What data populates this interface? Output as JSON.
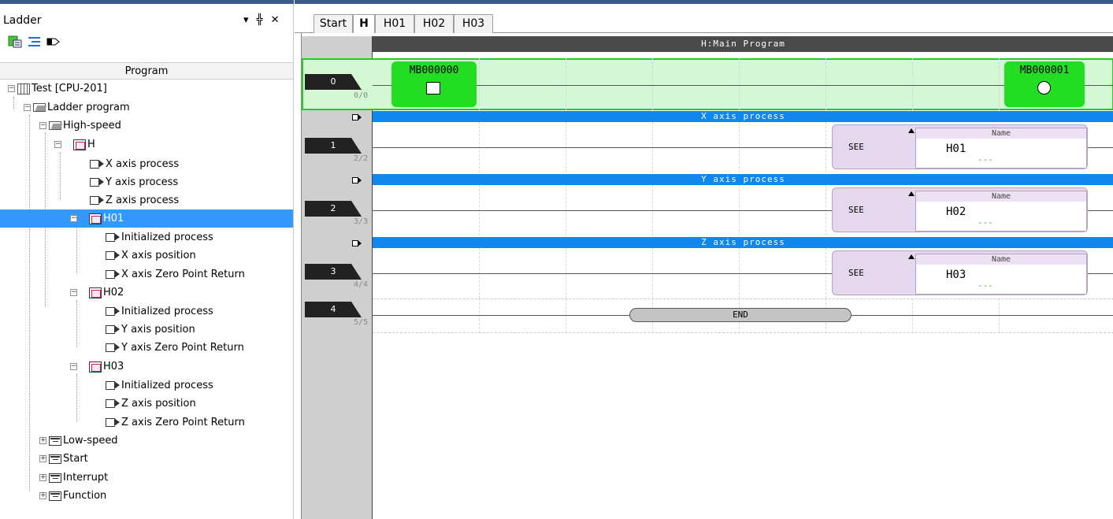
{
  "left_pane": {
    "title": "Ladder",
    "controls": "▾ ╬ ✕",
    "program_header": "Program",
    "tree": [
      {
        "label": "Test [CPU-201]",
        "icon": "cpu-icon"
      },
      {
        "label": "Ladder program",
        "icon": "folder-open-icon"
      },
      {
        "label": "High-speed",
        "icon": "folder-open-icon"
      },
      {
        "label": "H",
        "icon": "program-icon"
      },
      {
        "label": "X axis process",
        "icon": "tag-icon"
      },
      {
        "label": "Y axis process",
        "icon": "tag-icon"
      },
      {
        "label": "Z axis process",
        "icon": "tag-icon"
      },
      {
        "label": "H01",
        "icon": "program-icon",
        "selected": true
      },
      {
        "label": "Initialized process",
        "icon": "tag-icon"
      },
      {
        "label": "X axis position",
        "icon": "tag-icon"
      },
      {
        "label": "X axis Zero Point Return",
        "icon": "tag-icon"
      },
      {
        "label": "H02",
        "icon": "program-icon"
      },
      {
        "label": "Initialized process",
        "icon": "tag-icon"
      },
      {
        "label": "Y axis position",
        "icon": "tag-icon"
      },
      {
        "label": "Y axis Zero Point Return",
        "icon": "tag-icon"
      },
      {
        "label": "H03",
        "icon": "program-icon"
      },
      {
        "label": "Initialized process",
        "icon": "tag-icon"
      },
      {
        "label": "Z axis position",
        "icon": "tag-icon"
      },
      {
        "label": "Z axis Zero Point Return",
        "icon": "tag-icon"
      },
      {
        "label": "Low-speed",
        "icon": "group-icon"
      },
      {
        "label": "Start",
        "icon": "group-icon"
      },
      {
        "label": "Interrupt",
        "icon": "group-icon"
      },
      {
        "label": "Function",
        "icon": "group-icon"
      }
    ]
  },
  "tabs": [
    {
      "label": "Start"
    },
    {
      "label": "H",
      "active": true
    },
    {
      "label": "H01"
    },
    {
      "label": "H02"
    },
    {
      "label": "H03"
    }
  ],
  "ladder": {
    "header": "H:Main Program",
    "rungs": [
      {
        "number": "0",
        "count": "0/0"
      },
      {
        "number": "1",
        "count": "2/2"
      },
      {
        "number": "2",
        "count": "3/3"
      },
      {
        "number": "3",
        "count": "4/4"
      },
      {
        "number": "4",
        "count": "5/5"
      }
    ],
    "contact_in": {
      "label": "MB000000",
      "value": "---"
    },
    "coil_out": {
      "label": "MB000001",
      "value": "---"
    },
    "sections": [
      "X axis process",
      "Y axis process",
      "Z axis process"
    ],
    "see_blocks": [
      {
        "instr": "SEE",
        "name_header": "Name",
        "name": "H01",
        "value": "---"
      },
      {
        "instr": "SEE",
        "name_header": "Name",
        "name": "H02",
        "value": "---"
      },
      {
        "instr": "SEE",
        "name_header": "Name",
        "name": "H03",
        "value": "---"
      }
    ],
    "end_label": "END",
    "colors": {
      "contact": "#22dd22",
      "section_bar": "#0f87ee",
      "selected": "#3399ff"
    }
  }
}
